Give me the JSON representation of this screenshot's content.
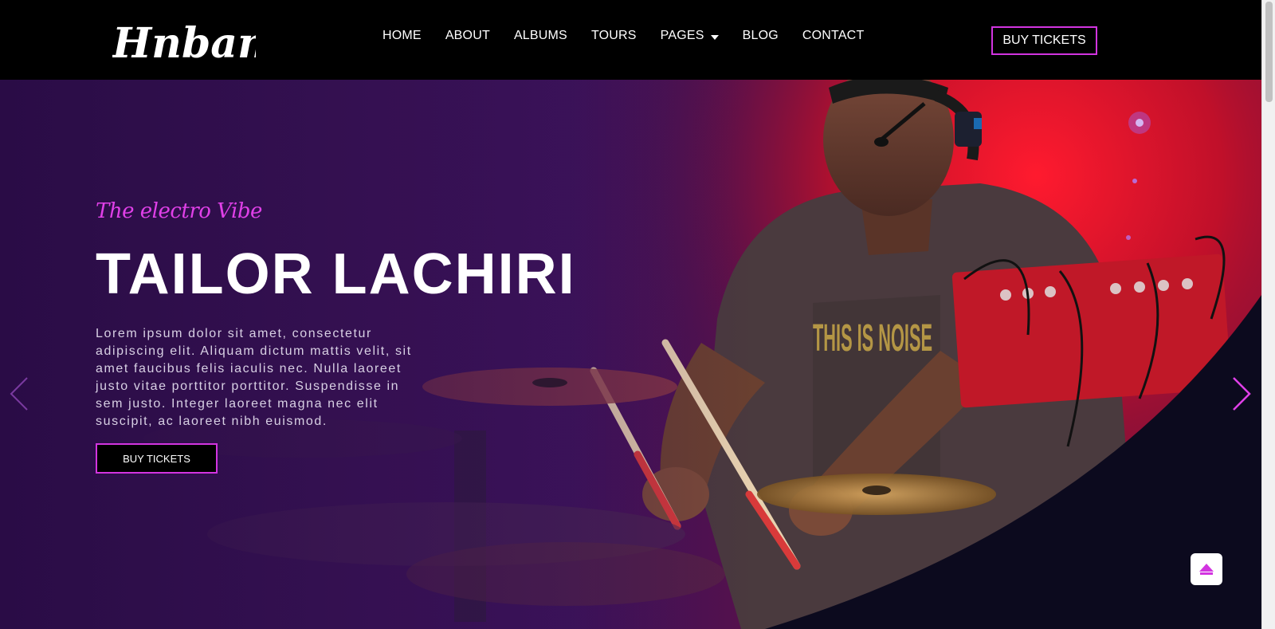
{
  "header": {
    "logo_text": "Hnband",
    "nav": [
      {
        "label": "HOME"
      },
      {
        "label": "ABOUT"
      },
      {
        "label": "ALBUMS"
      },
      {
        "label": "TOURS"
      },
      {
        "label": "PAGES"
      },
      {
        "label": "BLOG"
      },
      {
        "label": "CONTACT"
      }
    ],
    "buy_tickets_label": "BUY TICKETS"
  },
  "hero": {
    "tagline": "The electro Vibe",
    "title": "TAILOR LACHIRI",
    "description": "Lorem ipsum dolor sit amet, consectetur adipiscing elit. Aliquam dictum mattis velit, sit amet faucibus felis iaculis nec. Nulla laoreet justo vitae porttitor porttitor. Suspendisse in sem justo. Integer laoreet magna nec elit suscipit, ac laoreet nibh euismod.",
    "button_label": "BUY TICKETS",
    "shirt_text": "THIS IS NOISE"
  },
  "colors": {
    "accent": "#d234e0",
    "header_bg": "#000000",
    "hero_purple": "#3a1560",
    "hero_red": "#e0102a",
    "dark_navy": "#0c0a1e"
  },
  "icons": {
    "prev": "chevron-left-icon",
    "next": "chevron-right-icon",
    "back_to_top": "arrow-up-icon",
    "dropdown": "caret-down-icon"
  }
}
